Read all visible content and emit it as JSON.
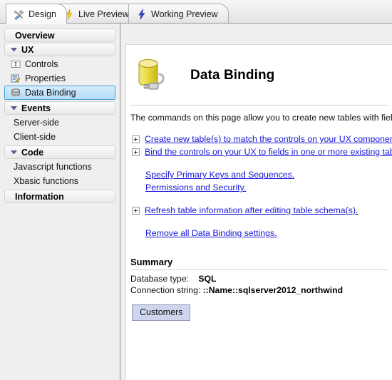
{
  "tabs": [
    {
      "label": "Design",
      "icon": "tools-icon",
      "active": true
    },
    {
      "label": "Live Preview",
      "icon": "lightning-yellow-icon",
      "active": false
    },
    {
      "label": "Working Preview",
      "icon": "lightning-blue-icon",
      "active": false
    }
  ],
  "sidebar": {
    "groups": [
      {
        "type": "header",
        "label": "Overview",
        "triangle": false
      },
      {
        "type": "header",
        "label": "UX",
        "triangle": true
      },
      {
        "type": "item",
        "label": "Controls",
        "icon": "textbox-icon",
        "selected": false
      },
      {
        "type": "item",
        "label": "Properties",
        "icon": "properties-icon",
        "selected": false
      },
      {
        "type": "item",
        "label": "Data Binding",
        "icon": "database-icon",
        "selected": true
      },
      {
        "type": "header",
        "label": "Events",
        "triangle": true
      },
      {
        "type": "item",
        "label": "Server-side",
        "icon": "",
        "selected": false
      },
      {
        "type": "item",
        "label": "Client-side",
        "icon": "",
        "selected": false
      },
      {
        "type": "header",
        "label": "Code",
        "triangle": true
      },
      {
        "type": "item",
        "label": "Javascript functions",
        "icon": "",
        "selected": false
      },
      {
        "type": "item",
        "label": "Xbasic functions",
        "icon": "",
        "selected": false
      },
      {
        "type": "header",
        "label": "Information",
        "triangle": false
      }
    ]
  },
  "page": {
    "title": "Data Binding",
    "icon": "database-plug-icon",
    "intro": "The commands on this page allow you to create new tables with fields that ma",
    "links_group1": [
      {
        "label": "Create new table(s) to match the controls on your UX component.",
        "expander": true
      },
      {
        "label": "Bind the controls on your UX to fields in one or more existing tables.",
        "expander": true
      }
    ],
    "links_group2": [
      {
        "label": "Specify Primary Keys and Sequences.",
        "expander": false
      },
      {
        "label": "Permissions and Security.",
        "expander": false
      }
    ],
    "links_group3": [
      {
        "label": "Refresh table information after editing table schema(s).",
        "expander": true
      }
    ],
    "links_group4": [
      {
        "label": "Remove all Data Binding settings.",
        "expander": false
      }
    ],
    "summary": {
      "title": "Summary",
      "database_type_label": "Database type:",
      "database_type_value": "SQL",
      "connection_string_label": "Connection string:",
      "connection_string_value": "::Name::sqlserver2012_northwind",
      "table_button": "Customers"
    }
  },
  "colors": {
    "link": "#1616d8",
    "selection_border": "#3f9fd8",
    "selection_fill": "#c3e4fa",
    "button_fill": "#cfd5ef",
    "db_icon_yellow": "#e8d94a"
  }
}
